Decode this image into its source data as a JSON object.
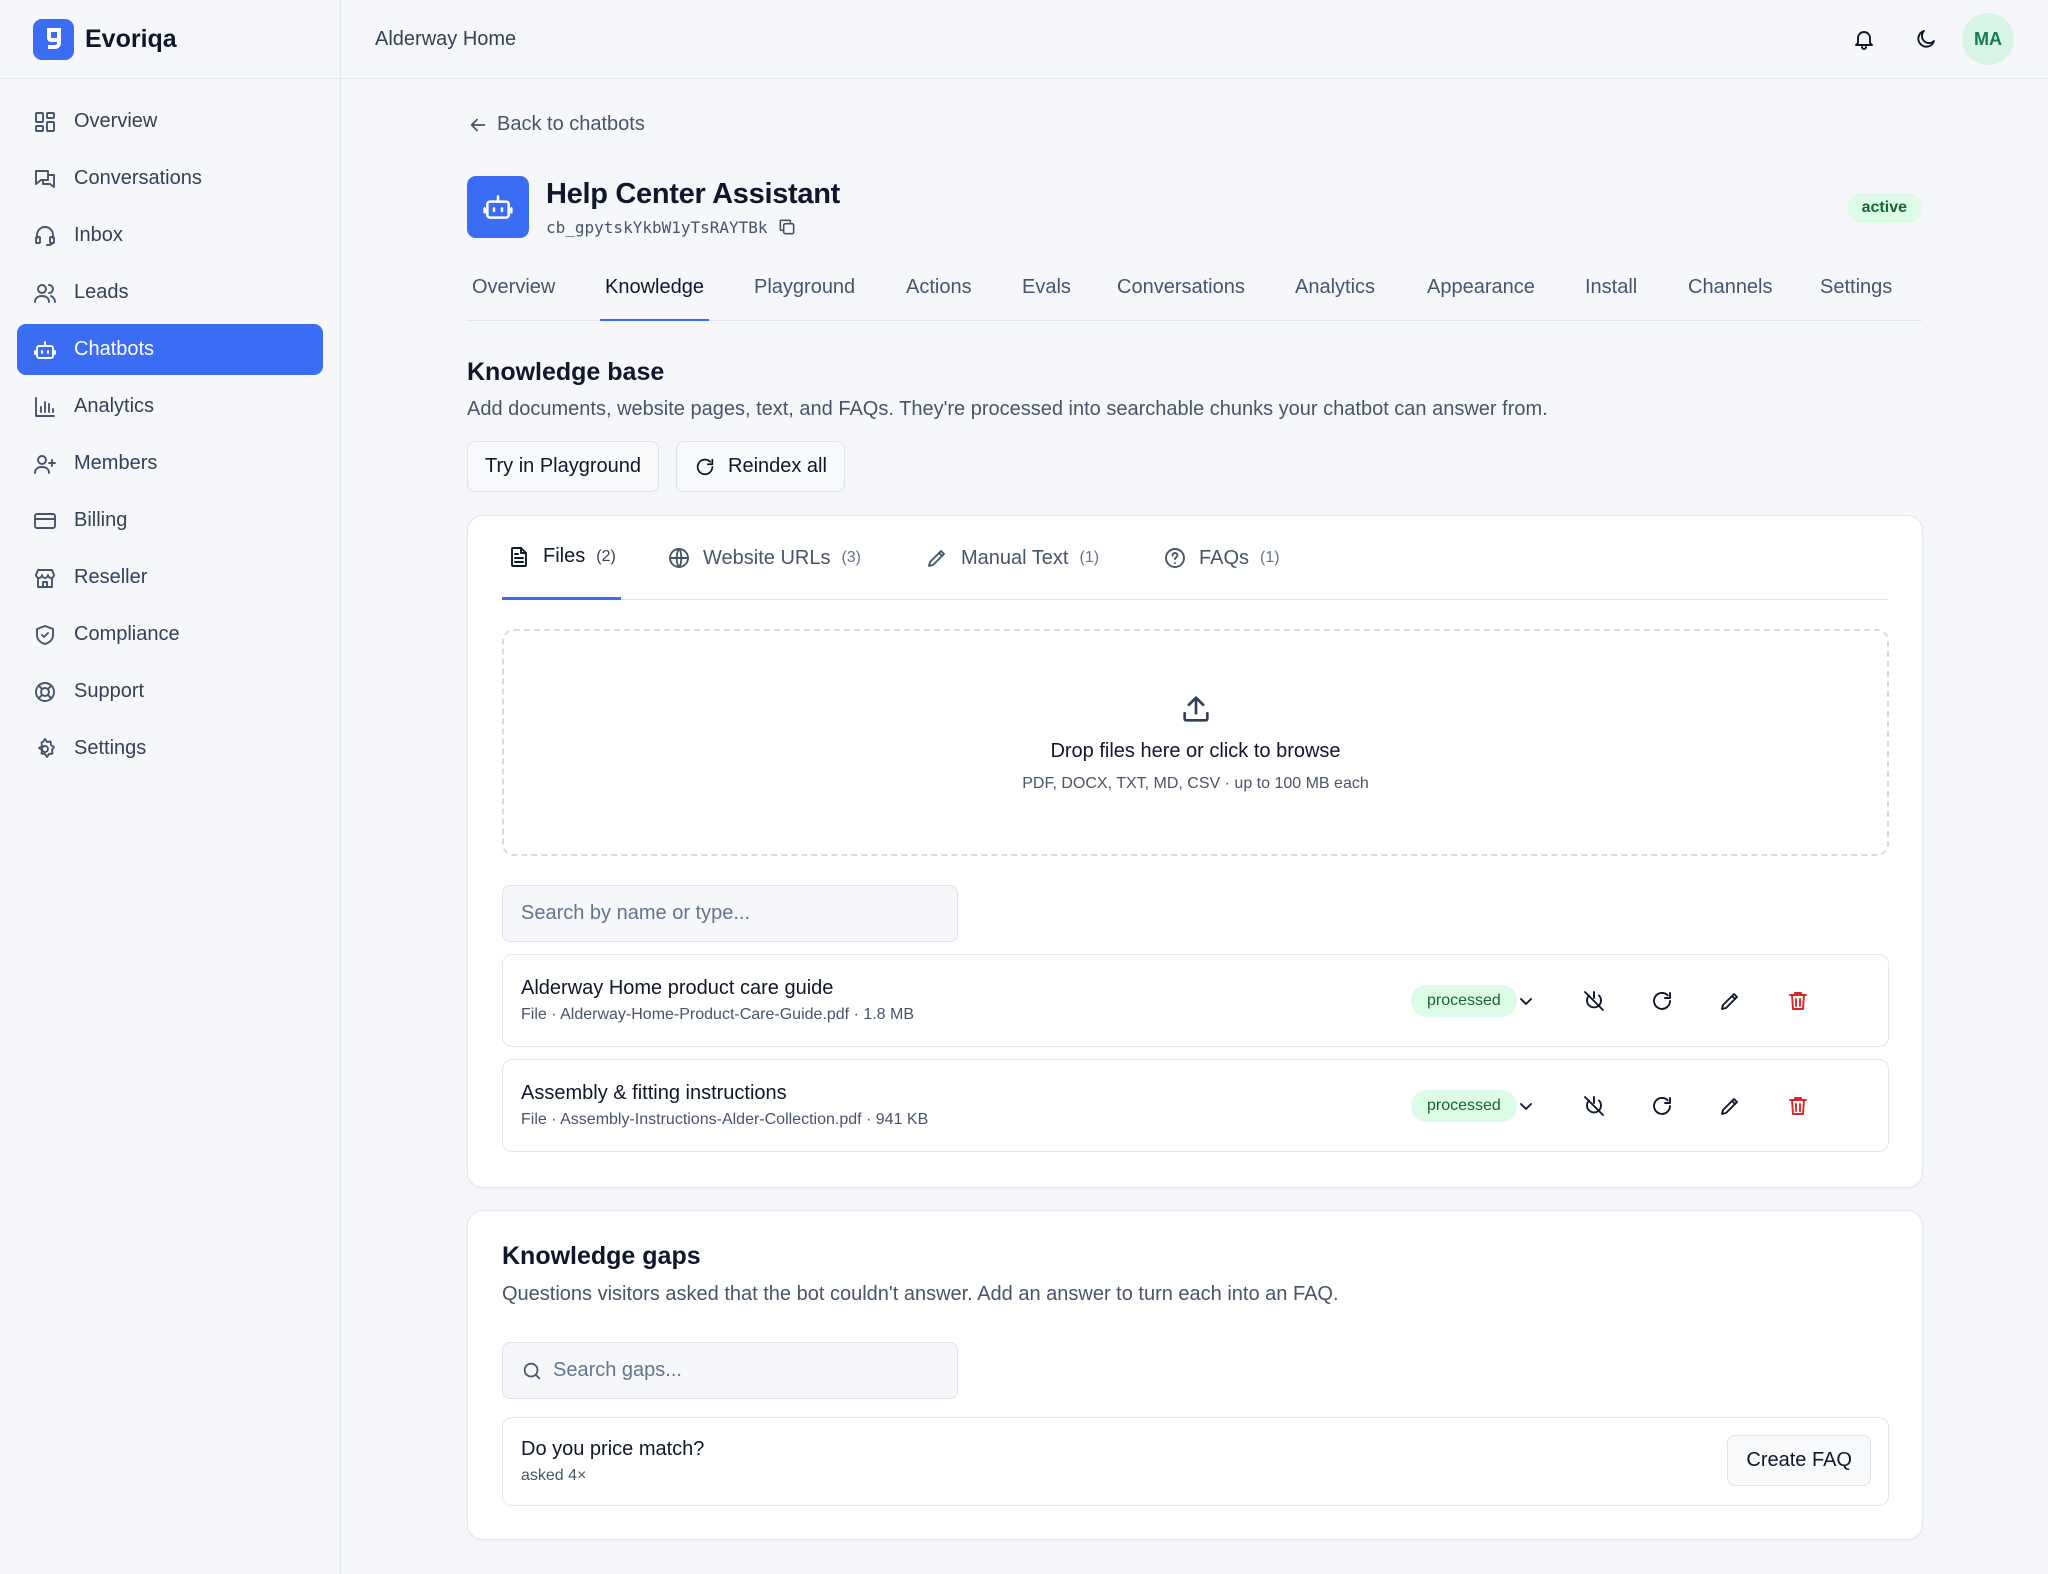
{
  "brand": {
    "name": "Evoriqa",
    "logo_icon": "brand-g-icon",
    "color": "#3b6cf4"
  },
  "sidebar": {
    "items": [
      {
        "label": "Overview",
        "icon": "dashboard-icon"
      },
      {
        "label": "Conversations",
        "icon": "chat-bubbles-icon"
      },
      {
        "label": "Inbox",
        "icon": "headset-icon"
      },
      {
        "label": "Leads",
        "icon": "users-icon"
      },
      {
        "label": "Chatbots",
        "icon": "robot-icon",
        "active": true
      },
      {
        "label": "Analytics",
        "icon": "bar-chart-icon"
      },
      {
        "label": "Members",
        "icon": "user-plus-icon"
      },
      {
        "label": "Billing",
        "icon": "credit-card-icon"
      },
      {
        "label": "Reseller",
        "icon": "store-icon"
      },
      {
        "label": "Compliance",
        "icon": "shield-check-icon"
      },
      {
        "label": "Support",
        "icon": "life-buoy-icon"
      },
      {
        "label": "Settings",
        "icon": "gear-icon"
      }
    ]
  },
  "topbar": {
    "workspace": "Alderway Home",
    "avatar_initials": "MA"
  },
  "page": {
    "back_label": "Back to chatbots",
    "bot_title": "Help Center Assistant",
    "bot_id": "cb_gpytskYkbW1yTsRAYTBk",
    "status": "active",
    "tabs": [
      "Overview",
      "Knowledge",
      "Playground",
      "Actions",
      "Evals",
      "Conversations",
      "Analytics",
      "Appearance",
      "Install",
      "Channels",
      "Settings"
    ],
    "active_tab": "Knowledge"
  },
  "knowledge": {
    "title": "Knowledge base",
    "description": "Add documents, website pages, text, and FAQs. They're processed into searchable chunks your chatbot can answer from.",
    "try_button": "Try in Playground",
    "reindex_button": "Reindex all",
    "source_tabs": [
      {
        "label": "Files",
        "count": "(2)",
        "icon": "file-icon",
        "active": true
      },
      {
        "label": "Website URLs",
        "count": "(3)",
        "icon": "globe-icon"
      },
      {
        "label": "Manual Text",
        "count": "(1)",
        "icon": "pencil-icon"
      },
      {
        "label": "FAQs",
        "count": "(1)",
        "icon": "help-circle-icon"
      }
    ],
    "dropzone": {
      "title": "Drop files here or click to browse",
      "hint": "PDF, DOCX, TXT, MD, CSV · up to 100 MB each"
    },
    "search_placeholder": "Search by name or type...",
    "files": [
      {
        "name": "Alderway Home product care guide",
        "meta": "File · Alderway-Home-Product-Care-Guide.pdf · 1.8 MB",
        "status": "processed"
      },
      {
        "name": "Assembly & fitting instructions",
        "meta": "File · Assembly-Instructions-Alder-Collection.pdf · 941 KB",
        "status": "processed"
      }
    ]
  },
  "gaps": {
    "title": "Knowledge gaps",
    "description": "Questions visitors asked that the bot couldn't answer. Add an answer to turn each into an FAQ.",
    "search_placeholder": "Search gaps...",
    "items": [
      {
        "question": "Do you price match?",
        "asked": "asked 4×",
        "action": "Create FAQ"
      }
    ]
  },
  "colors": {
    "accent": "#3b6cf4",
    "success_bg": "#dcfce7",
    "success_text": "#166534",
    "danger": "#dc2626"
  }
}
